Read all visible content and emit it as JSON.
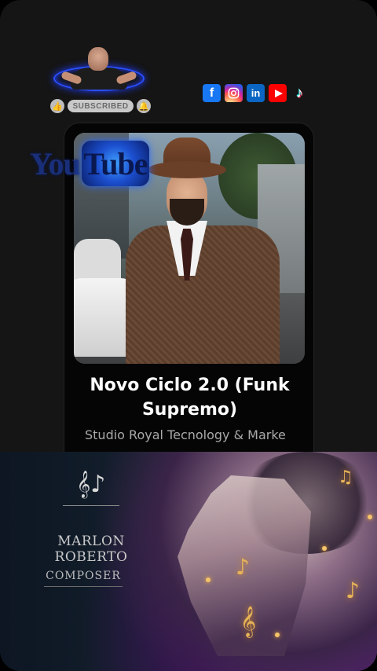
{
  "header": {
    "subscribe_label": "SUBSCRIBED",
    "like_icon": "thumbs-up-icon",
    "bell_icon": "bell-icon"
  },
  "socials": [
    {
      "name": "facebook",
      "glyph": "f",
      "color": "#1877f2"
    },
    {
      "name": "instagram",
      "glyph": "◎",
      "color": "#d6249f"
    },
    {
      "name": "linkedin",
      "glyph": "in",
      "color": "#0a66c2"
    },
    {
      "name": "youtube",
      "glyph": "▶",
      "color": "#ff0000"
    },
    {
      "name": "tiktok",
      "glyph": "♪",
      "color": "#ffffff"
    }
  ],
  "overlay_logo": {
    "left": "You",
    "right": "Tube"
  },
  "track": {
    "title": "Novo Ciclo 2.0 (Funk Supremo)",
    "artist": "Studio Royal Tecnology & Marke"
  },
  "banner": {
    "monogram": "𝄞♪",
    "name": "MARLON ROBERTO",
    "role": "COMPOSER"
  }
}
